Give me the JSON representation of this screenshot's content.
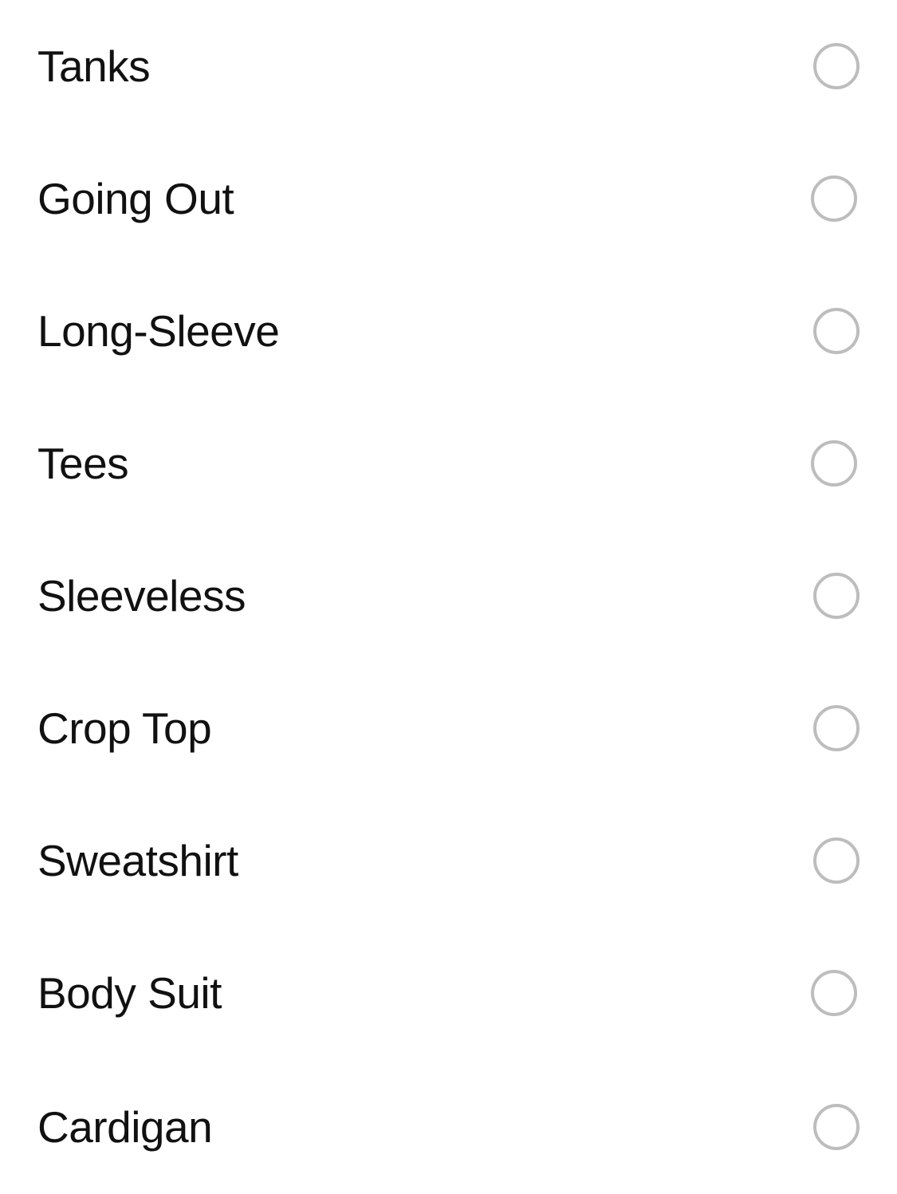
{
  "options": [
    {
      "label": "Tanks",
      "selected": false
    },
    {
      "label": "Going Out",
      "selected": false
    },
    {
      "label": "Long-Sleeve",
      "selected": false
    },
    {
      "label": "Tees",
      "selected": false
    },
    {
      "label": "Sleeveless",
      "selected": false
    },
    {
      "label": "Crop Top",
      "selected": false
    },
    {
      "label": "Sweatshirt",
      "selected": false
    },
    {
      "label": "Body Suit",
      "selected": false
    },
    {
      "label": "Cardigan",
      "selected": false
    }
  ],
  "colors": {
    "text": "#111111",
    "radio_border": "#bdbdbd",
    "background": "#ffffff"
  }
}
